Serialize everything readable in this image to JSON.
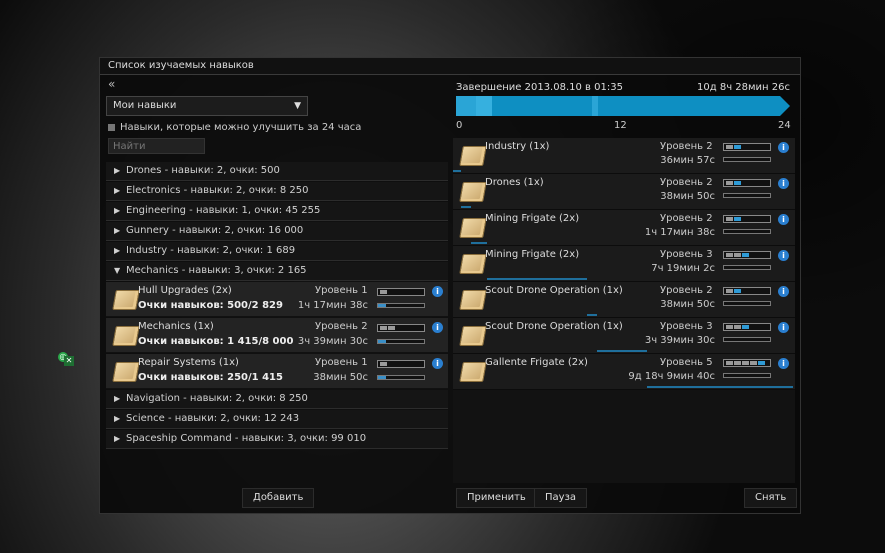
{
  "window": {
    "title": "Список изучаемых навыков"
  },
  "left": {
    "collapse_glyph": "«",
    "dropdown": "Мои навыки",
    "checkbox_label": "Навыки, которые можно улучшить за 24 часа",
    "search_placeholder": "Найти",
    "groups_top": [
      {
        "label": "Drones - навыки: 2, очки: 500"
      },
      {
        "label": "Electronics - навыки: 2, очки: 8 250"
      },
      {
        "label": "Engineering - навыки: 1, очки: 45 255"
      },
      {
        "label": "Gunnery - навыки: 2, очки: 16 000"
      },
      {
        "label": "Industry - навыки: 2, очки: 1 689"
      },
      {
        "label": "Mechanics - навыки: 3, очки: 2 165"
      }
    ],
    "skills": [
      {
        "name": "Hull Upgrades  (2x)",
        "points": "Очки навыков: 500/2 829",
        "level": "Уровень 1",
        "time": "1ч 17мин 38с",
        "level_num": 1,
        "progress": 0.18
      },
      {
        "name": "Mechanics  (1x)",
        "points": "Очки навыков: 1 415/8 000",
        "level": "Уровень 2",
        "time": "3ч 39мин 30с",
        "level_num": 2,
        "progress": 0.18
      },
      {
        "name": "Repair Systems  (1x)",
        "points": "Очки навыков: 250/1 415",
        "level": "Уровень 1",
        "time": "38мин 50с",
        "level_num": 1,
        "progress": 0.18
      }
    ],
    "groups_bottom": [
      {
        "label": "Navigation - навыки: 2, очки: 8 250"
      },
      {
        "label": "Science - навыки: 2, очки: 12 243"
      },
      {
        "label": "Spaceship Command - навыки: 3, очки: 99 010"
      }
    ],
    "add_button": "Добавить"
  },
  "right": {
    "completion": "Завершение 2013.08.10 в 01:35",
    "remaining": "10д 8ч 28мин 26с",
    "ticks": [
      "0",
      "12",
      "24"
    ],
    "queue": [
      {
        "name": "Industry  (1x)",
        "level": "Уровень 2",
        "time": "36мин 57с",
        "trained": 1,
        "training": 2,
        "progress": 0.05
      },
      {
        "name": "Drones  (1x)",
        "level": "Уровень 2",
        "time": "38мин 50с",
        "trained": 1,
        "training": 2,
        "progress": 0.05
      },
      {
        "name": "Mining Frigate  (2x)",
        "level": "Уровень 2",
        "time": "1ч 17мин 38с",
        "trained": 1,
        "training": 2,
        "progress": 0.05
      },
      {
        "name": "Mining Frigate  (2x)",
        "level": "Уровень 3",
        "time": "7ч 19мин 2с",
        "trained": 2,
        "training": 3,
        "progress": 0.05
      },
      {
        "name": "Scout Drone Operation  (1x)",
        "level": "Уровень 2",
        "time": "38мин 50с",
        "trained": 1,
        "training": 2,
        "progress": 0.05
      },
      {
        "name": "Scout Drone Operation  (1x)",
        "level": "Уровень 3",
        "time": "3ч 39мин 30с",
        "trained": 2,
        "training": 3,
        "progress": 0.05
      },
      {
        "name": "Gallente Frigate  (2x)",
        "level": "Уровень 5",
        "time": "9д 18ч 9мин 40с",
        "trained": 4,
        "training": 5,
        "progress": 0.05
      }
    ],
    "apply_button": "Применить",
    "pause_button": "Пауза",
    "remove_button": "Снять"
  }
}
